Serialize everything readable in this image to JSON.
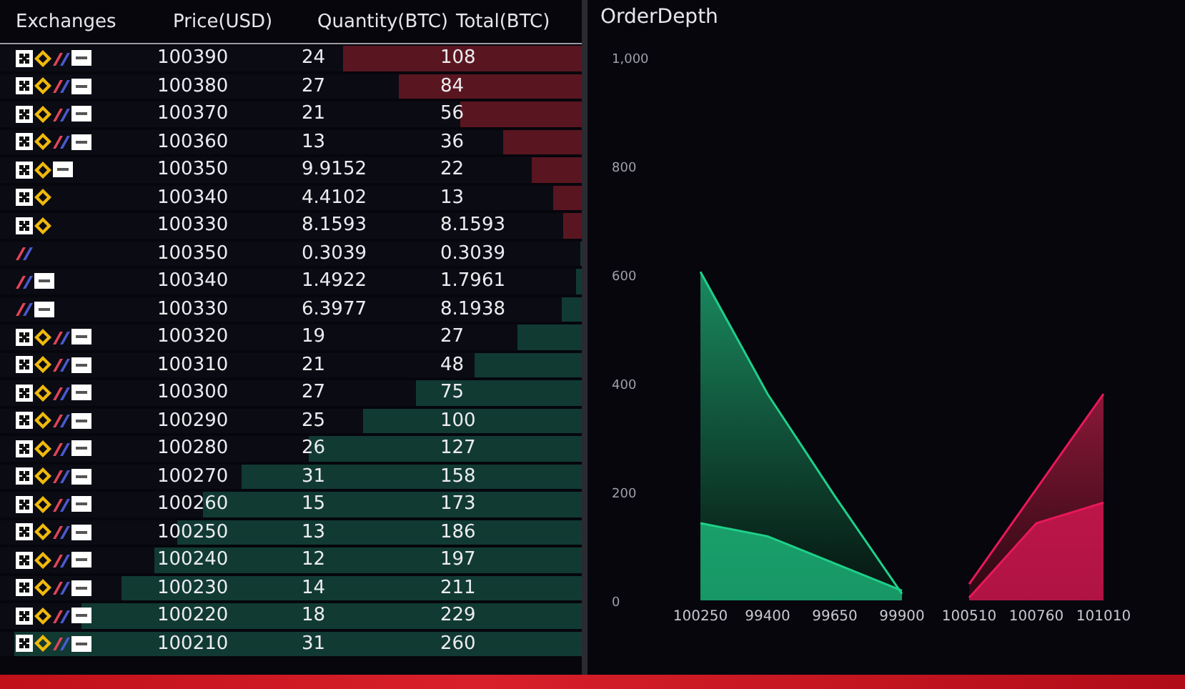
{
  "table": {
    "columns": [
      "Exchanges",
      "Price(USD)",
      "Quantity(BTC)",
      "Total(BTC)"
    ],
    "rows": [
      {
        "kind": "ask",
        "exchanges": [
          {
            "kind": "checker"
          },
          {
            "kind": "diamond"
          },
          {
            "kind": "slash"
          },
          {
            "kind": "tag"
          }
        ],
        "price": "100390",
        "quantity": "24",
        "total": "108",
        "level": 0.41
      },
      {
        "kind": "ask",
        "exchanges": [
          {
            "kind": "checker"
          },
          {
            "kind": "diamond"
          },
          {
            "kind": "slash"
          },
          {
            "kind": "tag"
          }
        ],
        "price": "100380",
        "quantity": "27",
        "total": "84",
        "level": 0.315
      },
      {
        "kind": "ask",
        "exchanges": [
          {
            "kind": "checker"
          },
          {
            "kind": "diamond"
          },
          {
            "kind": "slash"
          },
          {
            "kind": "tag"
          }
        ],
        "price": "100370",
        "quantity": "21",
        "total": "56",
        "level": 0.21
      },
      {
        "kind": "ask",
        "exchanges": [
          {
            "kind": "checker"
          },
          {
            "kind": "diamond"
          },
          {
            "kind": "slash"
          },
          {
            "kind": "tag"
          }
        ],
        "price": "100360",
        "quantity": "13",
        "total": "36",
        "level": 0.135
      },
      {
        "kind": "ask",
        "exchanges": [
          {
            "kind": "checker"
          },
          {
            "kind": "diamond"
          },
          {
            "kind": "tag"
          }
        ],
        "price": "100350",
        "quantity": "9.9152",
        "total": "22",
        "level": 0.086
      },
      {
        "kind": "ask",
        "exchanges": [
          {
            "kind": "checker"
          },
          {
            "kind": "diamond"
          }
        ],
        "price": "100340",
        "quantity": "4.4102",
        "total": "13",
        "level": 0.05
      },
      {
        "kind": "ask",
        "exchanges": [
          {
            "kind": "checker"
          },
          {
            "kind": "diamond"
          }
        ],
        "price": "100330",
        "quantity": "8.1593",
        "total": "8.1593",
        "level": 0.032
      },
      {
        "kind": "bid",
        "exchanges": [
          {
            "kind": "slash"
          }
        ],
        "price": "100350",
        "quantity": "0.3039",
        "total": "0.3039",
        "level": 0.002
      },
      {
        "kind": "bid",
        "exchanges": [
          {
            "kind": "slash"
          },
          {
            "kind": "tag"
          }
        ],
        "price": "100340",
        "quantity": "1.4922",
        "total": "1.7961",
        "level": 0.01
      },
      {
        "kind": "bid",
        "exchanges": [
          {
            "kind": "slash"
          },
          {
            "kind": "tag"
          }
        ],
        "price": "100330",
        "quantity": "6.3977",
        "total": "8.1938",
        "level": 0.034
      },
      {
        "kind": "bid",
        "exchanges": [
          {
            "kind": "checker"
          },
          {
            "kind": "diamond"
          },
          {
            "kind": "slash"
          },
          {
            "kind": "tag"
          }
        ],
        "price": "100320",
        "quantity": "19",
        "total": "27",
        "level": 0.11
      },
      {
        "kind": "bid",
        "exchanges": [
          {
            "kind": "checker"
          },
          {
            "kind": "diamond"
          },
          {
            "kind": "slash"
          },
          {
            "kind": "tag"
          }
        ],
        "price": "100310",
        "quantity": "21",
        "total": "48",
        "level": 0.185
      },
      {
        "kind": "bid",
        "exchanges": [
          {
            "kind": "checker"
          },
          {
            "kind": "diamond"
          },
          {
            "kind": "slash"
          },
          {
            "kind": "tag"
          }
        ],
        "price": "100300",
        "quantity": "27",
        "total": "75",
        "level": 0.285
      },
      {
        "kind": "bid",
        "exchanges": [
          {
            "kind": "checker"
          },
          {
            "kind": "diamond"
          },
          {
            "kind": "slash"
          },
          {
            "kind": "tag"
          }
        ],
        "price": "100290",
        "quantity": "25",
        "total": "100",
        "level": 0.375
      },
      {
        "kind": "bid",
        "exchanges": [
          {
            "kind": "checker"
          },
          {
            "kind": "diamond"
          },
          {
            "kind": "slash"
          },
          {
            "kind": "tag"
          }
        ],
        "price": "100280",
        "quantity": "26",
        "total": "127",
        "level": 0.47
      },
      {
        "kind": "bid",
        "exchanges": [
          {
            "kind": "checker"
          },
          {
            "kind": "diamond"
          },
          {
            "kind": "slash"
          },
          {
            "kind": "tag"
          }
        ],
        "price": "100270",
        "quantity": "31",
        "total": "158",
        "level": 0.585
      },
      {
        "kind": "bid",
        "exchanges": [
          {
            "kind": "checker"
          },
          {
            "kind": "diamond"
          },
          {
            "kind": "slash"
          },
          {
            "kind": "tag"
          }
        ],
        "price": "100260",
        "quantity": "15",
        "total": "173",
        "level": 0.65
      },
      {
        "kind": "bid",
        "exchanges": [
          {
            "kind": "checker"
          },
          {
            "kind": "diamond"
          },
          {
            "kind": "slash"
          },
          {
            "kind": "tag"
          }
        ],
        "price": "100250",
        "quantity": "13",
        "total": "186",
        "level": 0.695
      },
      {
        "kind": "bid",
        "exchanges": [
          {
            "kind": "checker"
          },
          {
            "kind": "diamond"
          },
          {
            "kind": "slash"
          },
          {
            "kind": "tag"
          }
        ],
        "price": "100240",
        "quantity": "12",
        "total": "197",
        "level": 0.735
      },
      {
        "kind": "bid",
        "exchanges": [
          {
            "kind": "checker"
          },
          {
            "kind": "diamond"
          },
          {
            "kind": "slash"
          },
          {
            "kind": "tag"
          }
        ],
        "price": "100230",
        "quantity": "14",
        "total": "211",
        "level": 0.79
      },
      {
        "kind": "bid",
        "exchanges": [
          {
            "kind": "checker"
          },
          {
            "kind": "diamond"
          },
          {
            "kind": "slash"
          },
          {
            "kind": "tag"
          }
        ],
        "price": "100220",
        "quantity": "18",
        "total": "229",
        "level": 0.86
      },
      {
        "kind": "bid",
        "exchanges": [
          {
            "kind": "checker"
          },
          {
            "kind": "diamond"
          },
          {
            "kind": "slash"
          },
          {
            "kind": "tag"
          }
        ],
        "price": "100210",
        "quantity": "31",
        "total": "260",
        "level": 0.975
      }
    ]
  },
  "depth": {
    "title": "OrderDepth",
    "chart_data": {
      "type": "area",
      "categories": [
        "100250",
        "99400",
        "99650",
        "99900",
        "100510",
        "100760",
        "101010"
      ],
      "ylim": [
        0,
        1000
      ],
      "yticks": [
        0,
        200,
        {
          "value": 400,
          "label": "400"
        },
        {
          "value": 600,
          "label": "600"
        },
        {
          "value": 800,
          "label": "800"
        },
        {
          "value": 1000,
          "label": "1,000"
        }
      ],
      "series": [
        {
          "color": "#1fd08a",
          "values": [
            605,
            380,
            192,
            12,
            null,
            null,
            null
          ]
        },
        {
          "color": "#1fd08a",
          "values": [
            142,
            118,
            68,
            18,
            null,
            null,
            null
          ]
        },
        {
          "color": "#e8185a",
          "values": [
            null,
            null,
            null,
            null,
            30,
            205,
            380
          ]
        },
        {
          "color": "#e8185a",
          "values": [
            null,
            null,
            null,
            null,
            5,
            142,
            180
          ]
        }
      ]
    }
  }
}
